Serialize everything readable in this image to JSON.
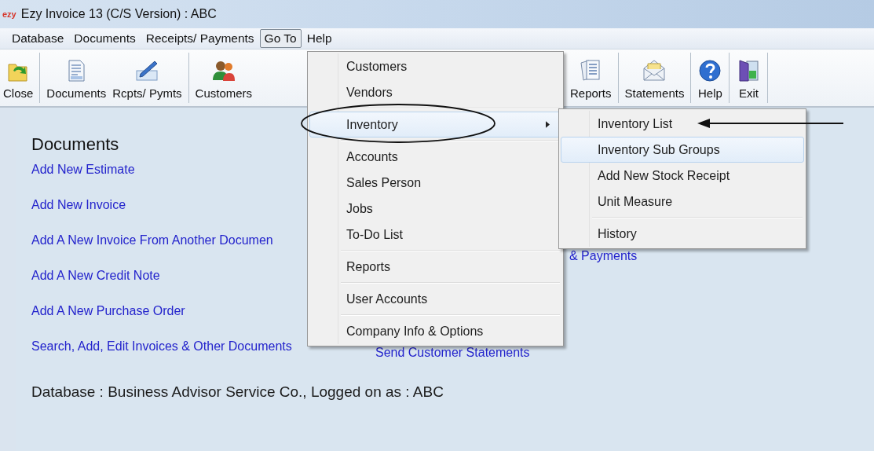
{
  "window": {
    "logo": "ezy",
    "title": "Ezy Invoice 13 (C/S Version) : ABC"
  },
  "menubar": [
    {
      "label": "Database",
      "selected": false
    },
    {
      "label": "Documents",
      "selected": false
    },
    {
      "label": "Receipts/ Payments",
      "selected": false
    },
    {
      "label": "Go To",
      "selected": true
    },
    {
      "label": "Help",
      "selected": false
    }
  ],
  "toolbar": {
    "left": [
      {
        "kind": "button",
        "label": "Close"
      },
      {
        "kind": "separator"
      },
      {
        "kind": "button",
        "label": "Documents"
      },
      {
        "kind": "button",
        "label": "Rcpts/ Pymts"
      },
      {
        "kind": "separator"
      },
      {
        "kind": "button",
        "label": "Customers"
      }
    ],
    "right": [
      {
        "kind": "button",
        "label": "Reports"
      },
      {
        "kind": "separator"
      },
      {
        "kind": "button",
        "label": "Statements"
      },
      {
        "kind": "separator"
      },
      {
        "kind": "button",
        "label": "Help"
      },
      {
        "kind": "separator"
      },
      {
        "kind": "button",
        "label": "Exit"
      },
      {
        "kind": "separator"
      }
    ]
  },
  "content": {
    "title": "Documents",
    "rows": [
      {
        "left": "Add New Estimate"
      },
      {
        "left": "Add New Invoice"
      },
      {
        "left": "Add A New Invoice From Another Documen",
        "right": "& Payments"
      },
      {
        "left": "Add A New Credit Note"
      },
      {
        "left": "Add A New Purchase Order"
      },
      {
        "left": "Search, Add, Edit Invoices & Other Documents",
        "center": "Send Customer Statements"
      }
    ],
    "status": "Database : Business Advisor Service Co.,  Logged on as : ABC"
  },
  "goto_menu": {
    "groups": [
      [
        {
          "label": "Customers",
          "selected": false,
          "has_submenu": false
        },
        {
          "label": "Vendors",
          "selected": false,
          "has_submenu": false
        }
      ],
      [
        {
          "label": "Inventory",
          "selected": true,
          "has_submenu": true
        }
      ],
      [
        {
          "label": "Accounts",
          "selected": false,
          "has_submenu": false
        },
        {
          "label": "Sales Person",
          "selected": false,
          "has_submenu": false
        },
        {
          "label": "Jobs",
          "selected": false,
          "has_submenu": false
        },
        {
          "label": "To-Do List",
          "selected": false,
          "has_submenu": false
        }
      ],
      [
        {
          "label": "Reports",
          "selected": false,
          "has_submenu": false
        }
      ],
      [
        {
          "label": "User Accounts",
          "selected": false,
          "has_submenu": false
        }
      ],
      [
        {
          "label": "Company Info & Options",
          "selected": false,
          "has_submenu": false
        }
      ]
    ]
  },
  "inventory_submenu": {
    "groups": [
      [
        {
          "label": "Inventory List",
          "selected": false
        },
        {
          "label": "Inventory Sub Groups",
          "selected": true
        },
        {
          "label": "Add New Stock Receipt",
          "selected": false
        },
        {
          "label": "Unit Measure",
          "selected": false
        }
      ],
      [
        {
          "label": "History",
          "selected": false
        }
      ]
    ]
  }
}
